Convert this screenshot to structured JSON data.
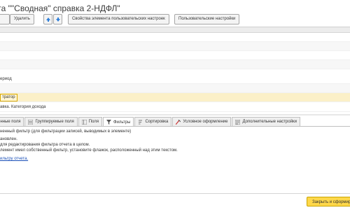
{
  "window": {
    "title": "ета \"\"Сводная\" справка 2-НДФЛ\""
  },
  "toolbar": {
    "delete_label": "Удалить",
    "up_icon": "arrow-up-icon",
    "down_icon": "arrow-down-icon",
    "properties_label": "Свойства элемента пользовательских настроек",
    "user_settings_label": "Пользовательские настройки"
  },
  "grid": {
    "rows": [
      {
        "text": ""
      },
      {
        "text": ""
      },
      {
        "text": ""
      },
      {
        "text": ""
      },
      {
        "text": "ериод"
      },
      {
        "text": ""
      },
      {
        "text": ""
      },
      {
        "text": "тратор"
      },
      {
        "text": "авка. Категория дохода"
      }
    ]
  },
  "tabs": [
    {
      "label": "енные поля",
      "icon": "none"
    },
    {
      "label": "Группируемые поля",
      "icon": "grouping-icon"
    },
    {
      "label": "Поля",
      "icon": "fields-icon"
    },
    {
      "label": "Фильтры",
      "icon": "filter-icon"
    },
    {
      "label": "Сортировка",
      "icon": "sort-icon"
    },
    {
      "label": "Условное оформление",
      "icon": "conditional-format-icon"
    },
    {
      "label": "Дополнительные настройки",
      "icon": "settings-icon"
    }
  ],
  "filter_panel": {
    "line1": "ненный фильтр (для фильтрации записей, выводимых в элементе)",
    "line2": "ановлен.",
    "line3": "для редактирования фильтра отчета в целом.",
    "line4": "лемент имел собственный фильтр, установите флажок, расположенный над этим текстом.",
    "link": "ильтру отчета."
  },
  "footer": {
    "close_label": "Закрыть и сформировать"
  },
  "colors": {
    "accent": "#ffd84a",
    "selection": "#fbf0c8",
    "link": "#1a4fb8"
  }
}
